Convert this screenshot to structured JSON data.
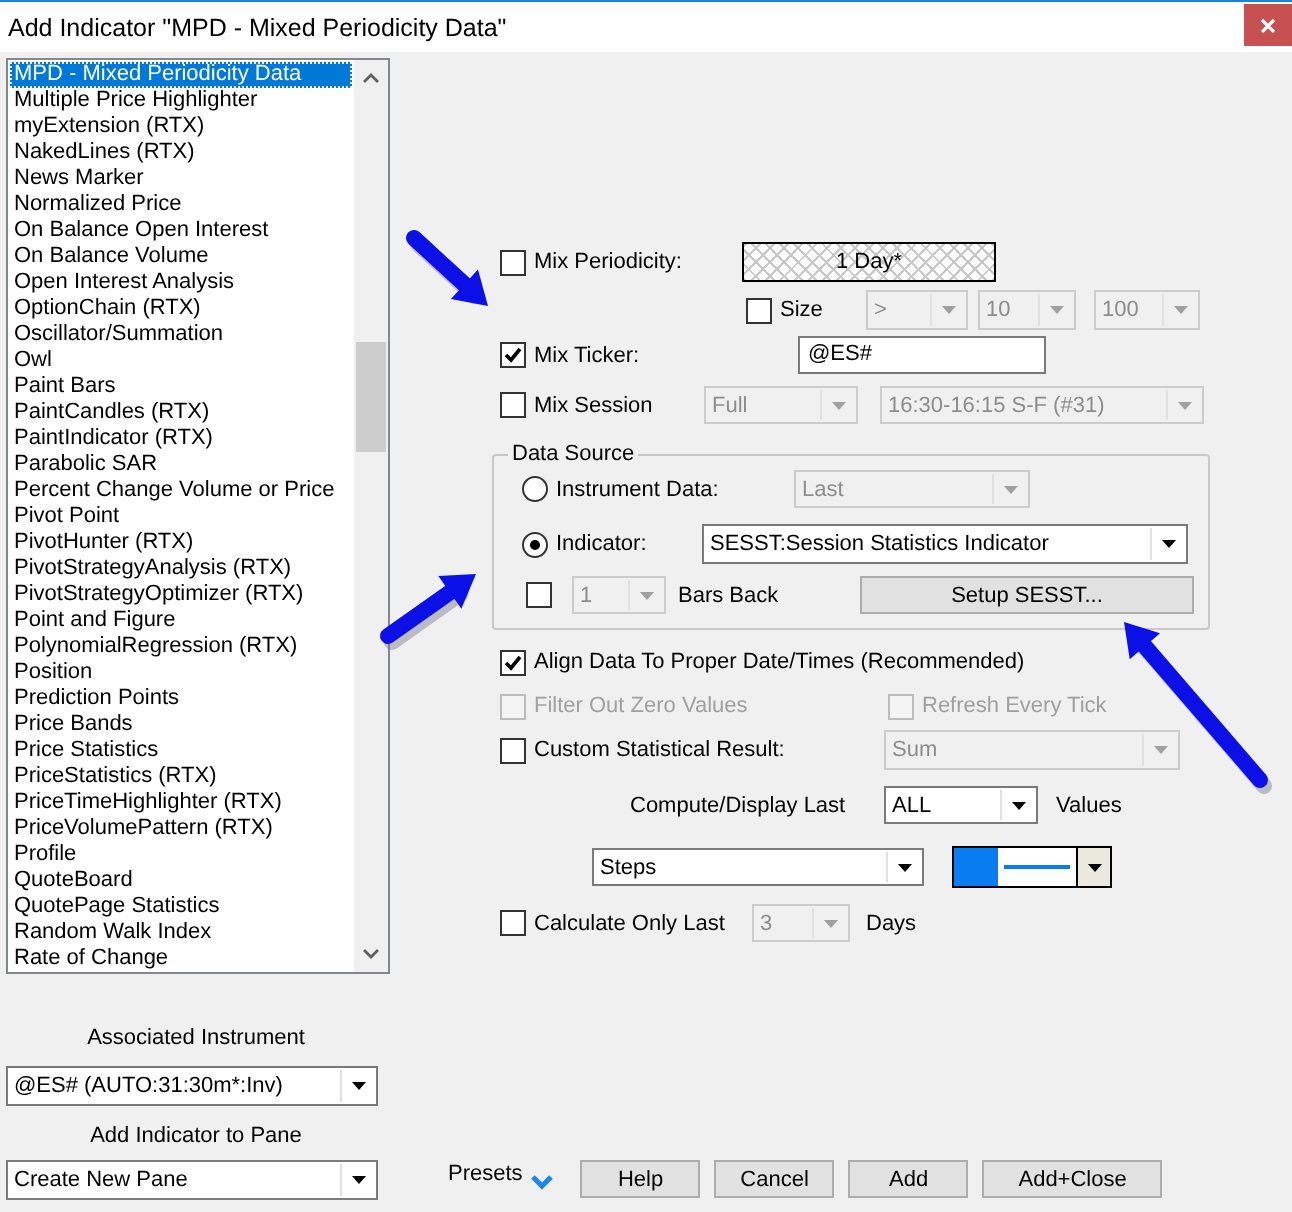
{
  "window": {
    "title": "Add Indicator \"MPD - Mixed Periodicity Data\""
  },
  "indicator_list": {
    "items": [
      {
        "label": "MPD - Mixed Periodicity Data",
        "selected": true
      },
      {
        "label": "Multiple Price Highlighter",
        "selected": false
      },
      {
        "label": "myExtension (RTX)",
        "selected": false
      },
      {
        "label": "NakedLines (RTX)",
        "selected": false
      },
      {
        "label": "News Marker",
        "selected": false
      },
      {
        "label": "Normalized Price",
        "selected": false
      },
      {
        "label": "On Balance Open Interest",
        "selected": false
      },
      {
        "label": "On Balance Volume",
        "selected": false
      },
      {
        "label": "Open Interest Analysis",
        "selected": false
      },
      {
        "label": "OptionChain (RTX)",
        "selected": false
      },
      {
        "label": "Oscillator/Summation",
        "selected": false
      },
      {
        "label": "Owl",
        "selected": false
      },
      {
        "label": "Paint Bars",
        "selected": false
      },
      {
        "label": "PaintCandles (RTX)",
        "selected": false
      },
      {
        "label": "PaintIndicator (RTX)",
        "selected": false
      },
      {
        "label": "Parabolic SAR",
        "selected": false
      },
      {
        "label": "Percent Change Volume or Price",
        "selected": false
      },
      {
        "label": "Pivot Point",
        "selected": false
      },
      {
        "label": "PivotHunter (RTX)",
        "selected": false
      },
      {
        "label": "PivotStrategyAnalysis (RTX)",
        "selected": false
      },
      {
        "label": "PivotStrategyOptimizer (RTX)",
        "selected": false
      },
      {
        "label": "Point and Figure",
        "selected": false
      },
      {
        "label": "PolynomialRegression (RTX)",
        "selected": false
      },
      {
        "label": "Position",
        "selected": false
      },
      {
        "label": "Prediction Points",
        "selected": false
      },
      {
        "label": "Price Bands",
        "selected": false
      },
      {
        "label": "Price Statistics",
        "selected": false
      },
      {
        "label": "PriceStatistics (RTX)",
        "selected": false
      },
      {
        "label": "PriceTimeHighlighter (RTX)",
        "selected": false
      },
      {
        "label": "PriceVolumePattern (RTX)",
        "selected": false
      },
      {
        "label": "Profile",
        "selected": false
      },
      {
        "label": "QuoteBoard",
        "selected": false
      },
      {
        "label": "QuotePage Statistics",
        "selected": false
      },
      {
        "label": "Random Walk Index",
        "selected": false
      },
      {
        "label": "Rate of Change",
        "selected": false
      }
    ]
  },
  "associated_instrument": {
    "label": "Associated Instrument",
    "value": "@ES# (AUTO:31:30m*:Inv)"
  },
  "add_to_pane": {
    "label": "Add Indicator to Pane",
    "value": "Create New Pane"
  },
  "mix_periodicity": {
    "label": "Mix Periodicity:",
    "checked": false,
    "value": "1 Day*"
  },
  "size": {
    "label": "Size",
    "checked": false,
    "operator": {
      "value": ">",
      "disabled": true
    },
    "from": {
      "value": "10",
      "disabled": true
    },
    "to": {
      "value": "100",
      "disabled": true
    }
  },
  "mix_ticker": {
    "label": "Mix Ticker:",
    "checked": true,
    "value": "@ES#"
  },
  "mix_session": {
    "label": "Mix Session",
    "checked": false,
    "type": {
      "value": "Full",
      "disabled": true
    },
    "session": {
      "value": "16:30-16:15 S-F (#31)",
      "disabled": true
    }
  },
  "data_source": {
    "title": "Data Source",
    "options": [
      {
        "label": "Instrument Data:",
        "selected": false,
        "value": "Last",
        "disabled": true
      },
      {
        "label": "Indicator:",
        "selected": true,
        "value": "SESST:Session Statistics Indicator",
        "disabled": false
      }
    ],
    "bars_back": {
      "checked": false,
      "value": "1",
      "disabled": true,
      "label": "Bars Back"
    },
    "setup_button": "Setup SESST..."
  },
  "align": {
    "label": "Align Data To Proper Date/Times (Recommended)",
    "checked": true
  },
  "filter_zero": {
    "label": "Filter Out Zero Values",
    "checked": false,
    "disabled": true
  },
  "refresh_tick": {
    "label": "Refresh Every Tick",
    "checked": false,
    "disabled": true
  },
  "custom_result": {
    "label": "Custom Statistical Result:",
    "checked": false,
    "value": "Sum",
    "disabled": true
  },
  "compute_last": {
    "label": "Compute/Display Last",
    "value": "ALL",
    "disabled": false,
    "unit": "Values"
  },
  "plot_style": {
    "value": "Steps",
    "disabled": false
  },
  "calculate_last": {
    "label": "Calculate Only Last",
    "checked": false,
    "value": "3",
    "disabled": true,
    "unit": "Days"
  },
  "footer": {
    "presets": "Presets",
    "buttons": [
      "Help",
      "Cancel",
      "Add",
      "Add+Close"
    ]
  }
}
